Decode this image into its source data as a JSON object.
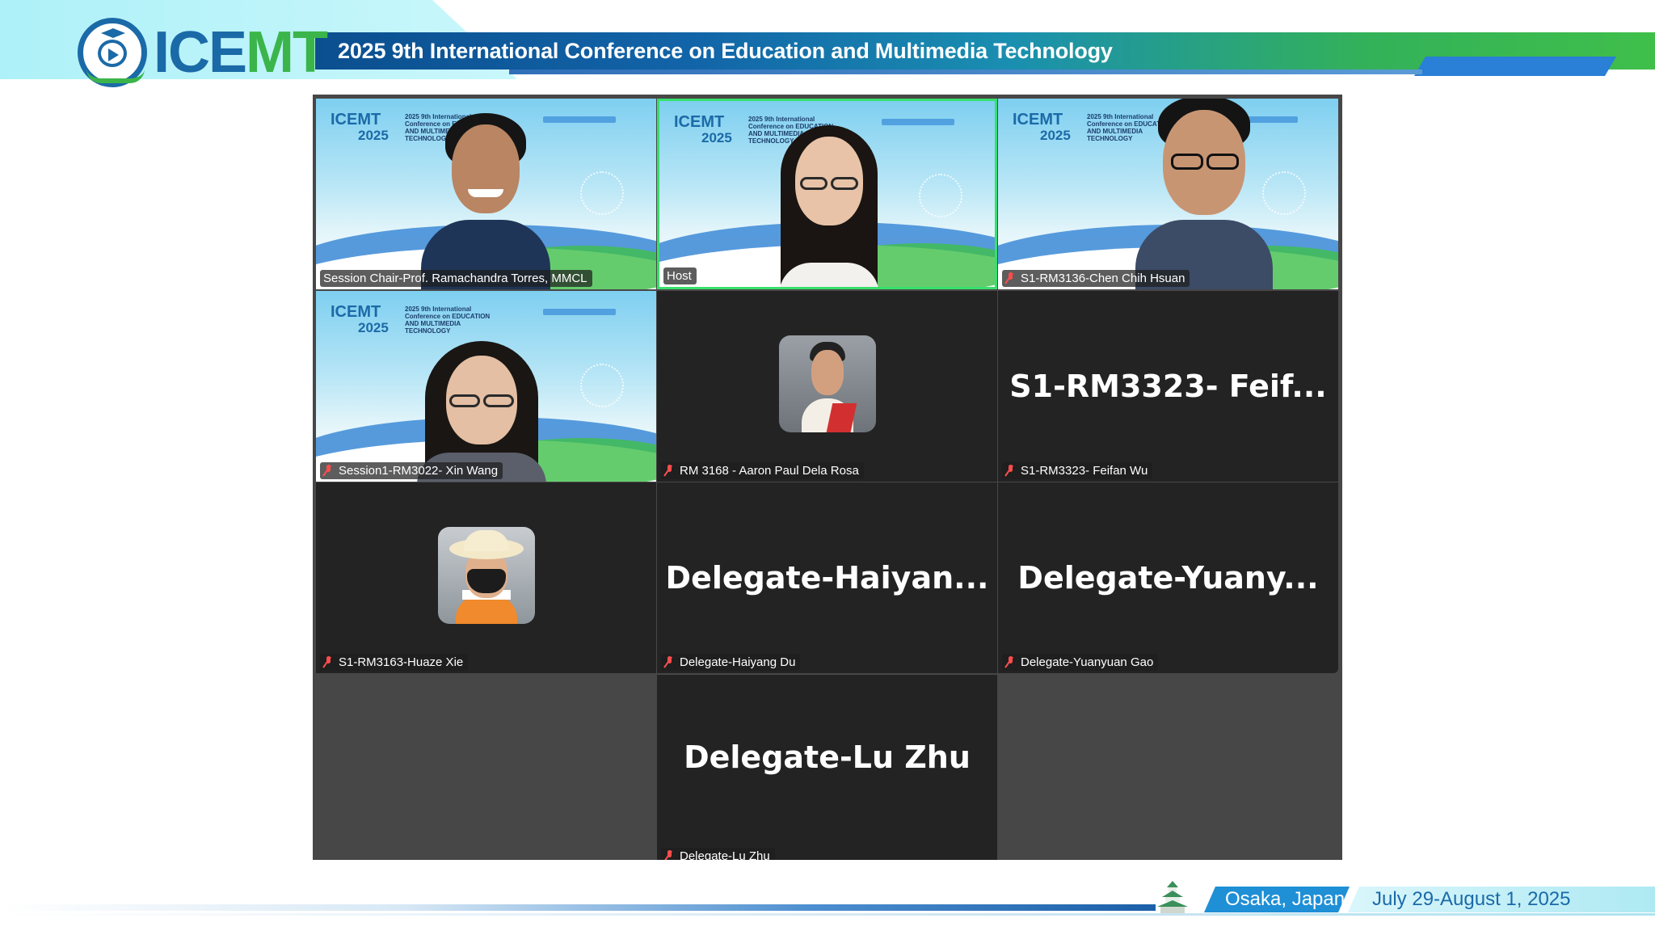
{
  "header": {
    "logo_text_a": "ICE",
    "logo_text_b": "MT",
    "title": "2025 9th International Conference on Education and Multimedia Technology"
  },
  "gallery": {
    "tiles": [
      {
        "name": "Session Chair-Prof. Ramachandra Torres, MMCL",
        "muted": false,
        "type": "video"
      },
      {
        "name": "Host",
        "muted": false,
        "type": "video",
        "active": true
      },
      {
        "name": "S1-RM3136-Chen Chih Hsuan",
        "muted": true,
        "type": "video"
      },
      {
        "name": "Session1-RM3022- Xin Wang",
        "muted": true,
        "type": "video"
      },
      {
        "name": "RM 3168 - Aaron Paul Dela Rosa",
        "muted": true,
        "type": "avatar"
      },
      {
        "name": "S1-RM3323- Feifan Wu",
        "display": "S1-RM3323-  Feif...",
        "muted": true,
        "type": "name"
      },
      {
        "name": "S1-RM3163-Huaze Xie",
        "muted": true,
        "type": "avatar"
      },
      {
        "name": "Delegate-Haiyang Du",
        "display": "Delegate-Haiyan...",
        "muted": true,
        "type": "name"
      },
      {
        "name": "Delegate-Yuanyuan Gao",
        "display": "Delegate-Yuany...",
        "muted": true,
        "type": "name"
      },
      {
        "name": "Delegate-Lu Zhu",
        "display": "Delegate-Lu Zhu",
        "muted": true,
        "type": "name"
      }
    ],
    "virtual_bg": {
      "logo": "ICEMT",
      "year": "2025",
      "subtitle": "2025 9th International Conference on EDUCATION AND MULTIMEDIA TECHNOLOGY"
    }
  },
  "footer": {
    "location": "Osaka, Japan",
    "dates": "July 29-August 1, 2025"
  },
  "colors": {
    "brand_blue": "#1b6aa8",
    "brand_green": "#3bb54a",
    "active_speaker": "#37e06c",
    "muted_icon": "#ff4d4d",
    "gallery_bg": "#474747",
    "tile_bg": "#232323"
  }
}
